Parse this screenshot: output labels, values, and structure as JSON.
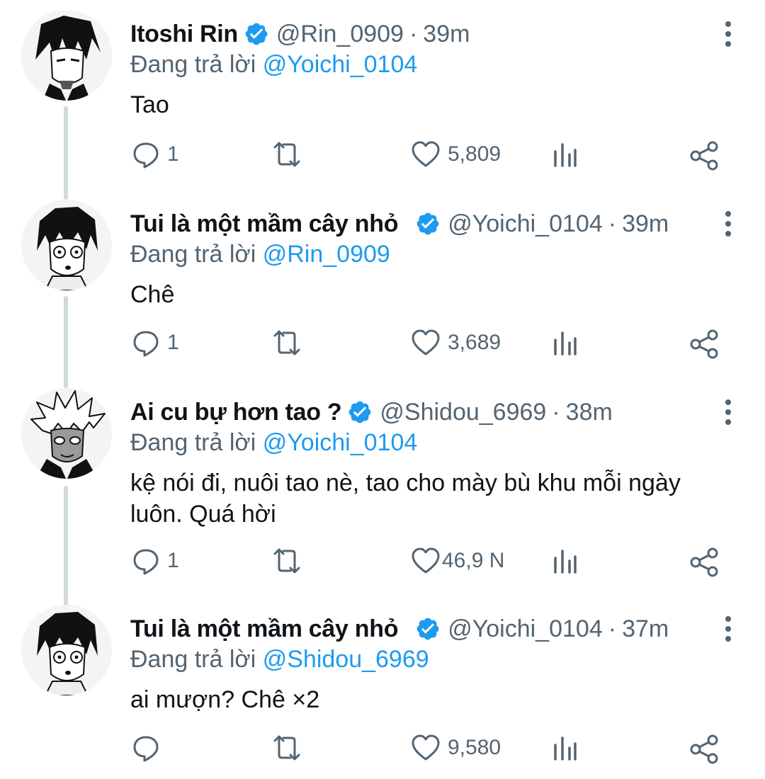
{
  "tweets": [
    {
      "name": "Itoshi Rin",
      "handle": "@Rin_0909",
      "separator": "·",
      "time": "39m",
      "reply_prefix": "Đang trả lời",
      "reply_to": "@Yoichi_0104",
      "text": "Tao",
      "replies": "1",
      "likes": "5,809",
      "avatar": "character-black-hair-sharp-eyes"
    },
    {
      "name": "Tui là một mầm cây nhỏ",
      "handle": "@Yoichi_0104",
      "separator": "·",
      "time": "39m",
      "reply_prefix": "Đang trả lời",
      "reply_to": "@Rin_0909",
      "text": "Chê",
      "replies": "1",
      "likes": "3,689",
      "avatar": "character-black-hair-shocked"
    },
    {
      "name": "Ai cu bự hơn tao ?",
      "handle": "@Shidou_6969",
      "separator": "·",
      "time": "38m",
      "reply_prefix": "Đang trả lời",
      "reply_to": "@Yoichi_0104",
      "text": "kệ nói đi, nuôi tao nè, tao cho mày bù khu mỗi ngày luôn. Quá hời",
      "replies": "1",
      "likes": "46,9 N",
      "avatar": "character-spiky-white-hair"
    },
    {
      "name": "Tui là một mầm cây nhỏ",
      "handle": "@Yoichi_0104",
      "separator": "·",
      "time": "37m",
      "reply_prefix": "Đang trả lời",
      "reply_to": "@Shidou_6969",
      "text": "ai mượn? Chê ×2",
      "replies": "",
      "likes": "9,580",
      "avatar": "character-black-hair-shocked"
    }
  ],
  "icons": {
    "verified": "verified-badge-icon",
    "more": "more-vertical-icon",
    "reply": "reply-bubble-icon",
    "retweet": "retweet-icon",
    "like": "heart-icon",
    "views": "analytics-bars-icon",
    "share": "share-nodes-icon"
  },
  "colors": {
    "accent": "#1d9bf0",
    "secondary_text": "#536471",
    "primary_text": "#0f1419",
    "thread_line": "#cfd9de"
  }
}
